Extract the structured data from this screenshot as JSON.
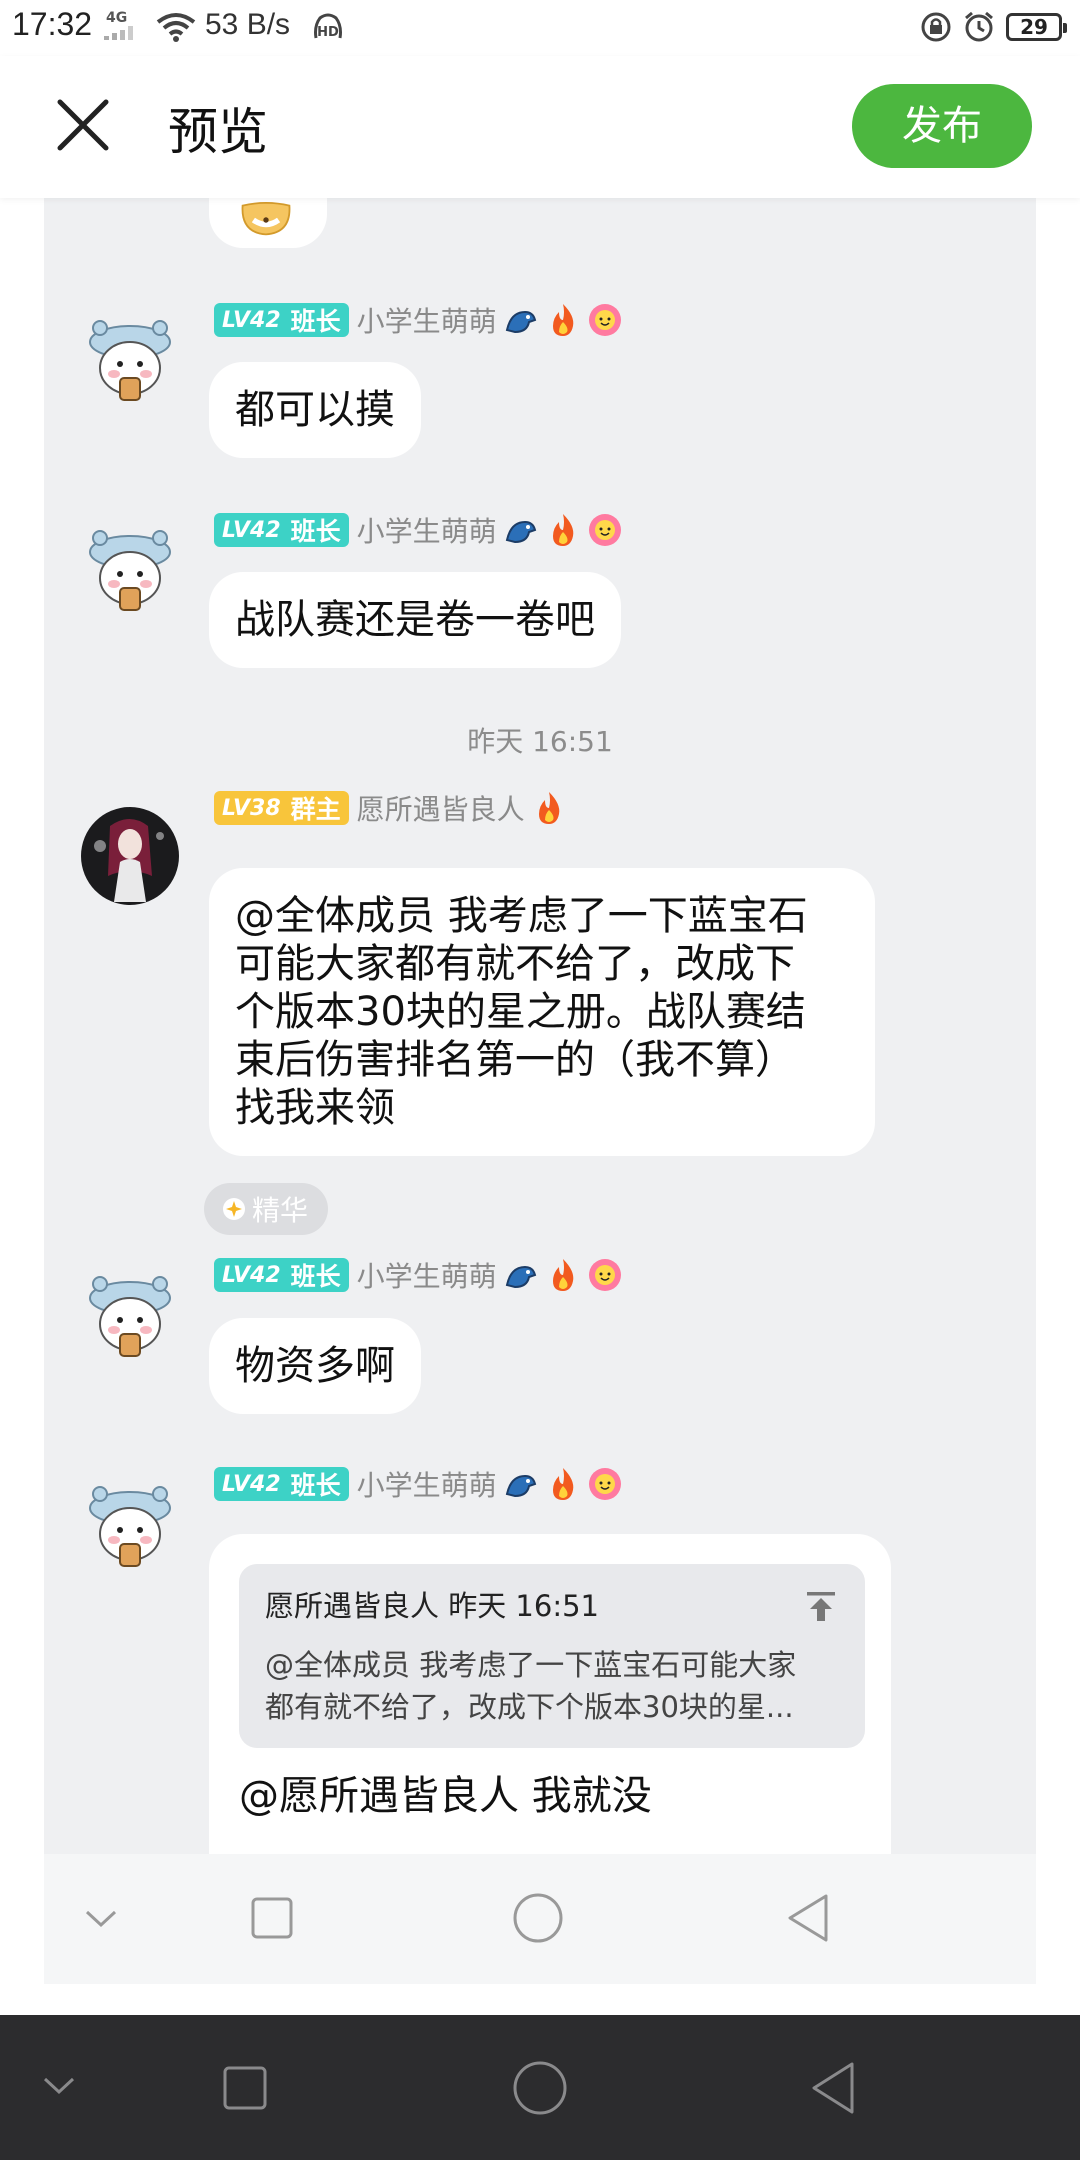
{
  "status_bar": {
    "time": "17:32",
    "network": "4G",
    "speed": "53 B/s",
    "battery": "29"
  },
  "header": {
    "title": "预览",
    "publish_label": "发布"
  },
  "colors": {
    "accent": "#4cb73f",
    "badge_teal": "#3dd2c6",
    "badge_gold": "#f8c53b",
    "chat_bg": "#eff0f2"
  },
  "messages": [
    {
      "level": "LV42",
      "role": "班长",
      "user": "小学生萌萌",
      "text": "都可以摸"
    },
    {
      "level": "LV42",
      "role": "班长",
      "user": "小学生萌萌",
      "text": "战队赛还是卷一卷吧"
    },
    {
      "level": "LV38",
      "role": "群主",
      "user": "愿所遇皆良人",
      "lines": [
        "@全体成员 我考虑了一下蓝宝石",
        "可能大家都有就不给了，改成下",
        "个版本30块的星之册。战队赛结",
        "束后伤害排名第一的（我不算）",
        "找我来领"
      ]
    },
    {
      "level": "LV42",
      "role": "班长",
      "user": "小学生萌萌",
      "text": "物资多啊"
    },
    {
      "level": "LV42",
      "role": "班长",
      "user": "小学生萌萌",
      "quote": {
        "author_time": "愿所遇皆良人 昨天 16:51",
        "line1": "@全体成员 我考虑了一下蓝宝石可能大家",
        "line2": "都有就不给了，改成下个版本30块的星..."
      },
      "text": "@愿所遇皆良人 我就没"
    }
  ],
  "timestamp": "昨天 16:51",
  "essence_tag": "精华"
}
